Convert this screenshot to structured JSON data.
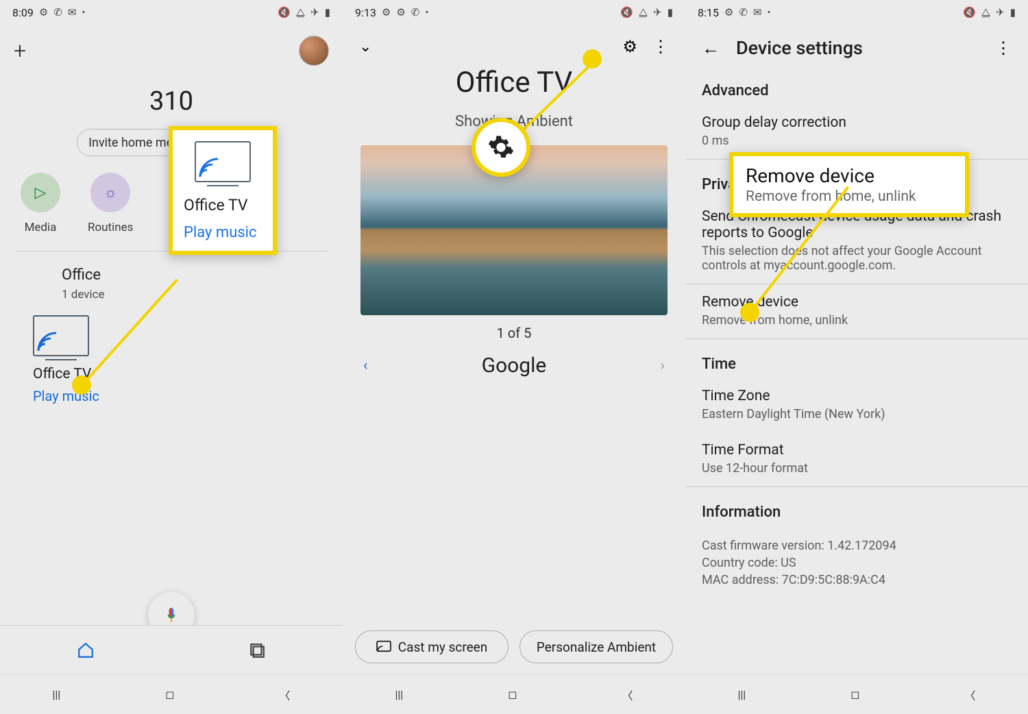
{
  "phone1": {
    "status": {
      "time": "8:09",
      "left_icons": [
        "gear-icon",
        "call-icon",
        "mail-icon",
        "dot-icon"
      ],
      "right_icons": [
        "mute-icon",
        "wifi-icon",
        "airplane-icon",
        "battery-icon"
      ]
    },
    "home_title": "310",
    "chips": {
      "invite": "Invite home member",
      "close_glyph": "✕"
    },
    "quick": {
      "media": "Media",
      "routines": "Routines"
    },
    "section": {
      "name": "Office",
      "sub": "1 device"
    },
    "device": {
      "name": "Office TV",
      "action": "Play music"
    },
    "tabs": {
      "home": "home-icon",
      "articles": "articles-icon"
    }
  },
  "phone2": {
    "status": {
      "time": "9:13",
      "left_icons": [
        "gear-icon",
        "gear-icon",
        "call-icon",
        "dot-icon"
      ],
      "right_icons": [
        "mute-icon",
        "wifi-icon",
        "airplane-icon",
        "battery-icon"
      ]
    },
    "title": "Office TV",
    "subtitle": "Showing Ambient",
    "pager": "1 of 5",
    "assistant": "Google",
    "buttons": {
      "cast": "Cast my screen",
      "personalize": "Personalize Ambient"
    }
  },
  "phone3": {
    "status": {
      "time": "8:15",
      "left_icons": [
        "gear-icon",
        "call-icon",
        "mail-icon",
        "dot-icon"
      ],
      "right_icons": [
        "mute-icon",
        "wifi-icon",
        "airplane-icon",
        "battery-icon"
      ]
    },
    "title": "Device settings",
    "advanced": {
      "header": "Advanced",
      "group_delay_t": "Group delay correction",
      "group_delay_s": "0 ms"
    },
    "privacy": {
      "header": "Privacy",
      "send_t": "Send Chromecast device usage data and crash reports to Google",
      "send_s": "This selection does not affect your Google Account controls at myaccount.google.com."
    },
    "remove": {
      "t": "Remove device",
      "s": "Remove from home, unlink"
    },
    "time": {
      "header": "Time",
      "zone_t": "Time Zone",
      "zone_s": "Eastern Daylight Time (New York)",
      "format_t": "Time Format",
      "format_s": "Use 12-hour format"
    },
    "info": {
      "header": "Information",
      "fw": "Cast firmware version: 1.42.172094",
      "cc": "Country code: US",
      "mac": "MAC address: 7C:D9:5C:88:9A:C4"
    }
  },
  "callout1": {
    "name": "Office TV",
    "action": "Play music"
  },
  "callout3": {
    "t": "Remove device",
    "s": "Remove from home, unlink"
  }
}
